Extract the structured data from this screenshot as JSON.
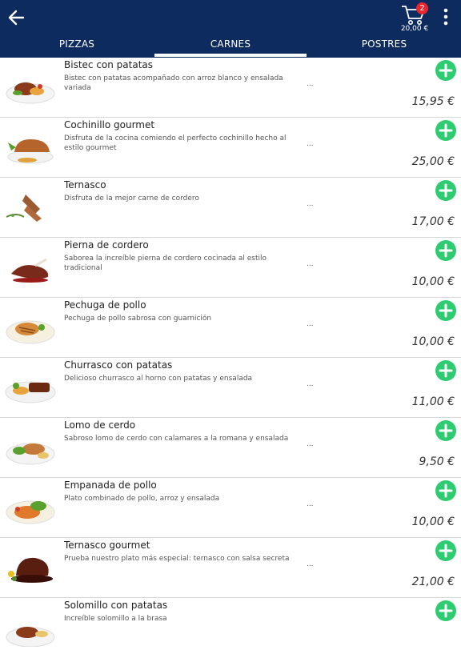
{
  "header": {
    "cart_count": "2",
    "cart_total": "20,00 €",
    "colors": {
      "bar": "#0d2b5e",
      "add": "#2ecc71",
      "badge": "#e8262c"
    }
  },
  "tabs": [
    {
      "label": "PIZZAS",
      "active": false
    },
    {
      "label": "CARNES",
      "active": true
    },
    {
      "label": "POSTRES",
      "active": false
    }
  ],
  "items": [
    {
      "name": "Bistec con patatas",
      "desc": "Bistec con patatas acompañado con arroz blanco y ensalada variada",
      "ellipsis": "...",
      "price": "15,95 €",
      "icon": "steak-plate-icon"
    },
    {
      "name": "Cochinillo gourmet",
      "desc": "Disfruta de la cocina comiendo el perfecto cochinillo hecho al estilo gourmet",
      "ellipsis": "...",
      "price": "25,00 €",
      "icon": "roast-piglet-icon"
    },
    {
      "name": "Ternasco",
      "desc": "Disfruta de la mejor carne de cordero",
      "ellipsis": "...",
      "price": "17,00 €",
      "icon": "lamb-chops-icon"
    },
    {
      "name": "Pierna de cordero",
      "desc": "Saborea la increíble pierna de cordero cocinada al estilo tradicional",
      "ellipsis": "...",
      "price": "10,00 €",
      "icon": "lamb-leg-icon"
    },
    {
      "name": "Pechuga de pollo",
      "desc": "Pechuga de pollo sabrosa con guarnición",
      "ellipsis": "...",
      "price": "10,00 €",
      "icon": "chicken-breast-icon"
    },
    {
      "name": "Churrasco con patatas",
      "desc": "Delicioso churrasco al horno con patatas y ensalada",
      "ellipsis": "...",
      "price": "11,00 €",
      "icon": "ribs-plate-icon"
    },
    {
      "name": "Lomo de cerdo",
      "desc": "Sabroso lomo de cerdo con calamares a la romana y ensalada",
      "ellipsis": "...",
      "price": "9,50 €",
      "icon": "pork-loin-icon"
    },
    {
      "name": "Empanada de pollo",
      "desc": "Plato combinado de pollo, arroz y ensalada",
      "ellipsis": "...",
      "price": "10,00 €",
      "icon": "chicken-plate-icon"
    },
    {
      "name": "Ternasco gourmet",
      "desc": "Prueba nuestro plato más especial: ternasco con salsa secreta",
      "ellipsis": "...",
      "price": "21,00 €",
      "icon": "gourmet-lamb-icon"
    },
    {
      "name": "Solomillo con patatas",
      "desc": "Increíble solomillo a la brasa",
      "ellipsis": "...",
      "price": "",
      "icon": "sirloin-icon"
    }
  ]
}
